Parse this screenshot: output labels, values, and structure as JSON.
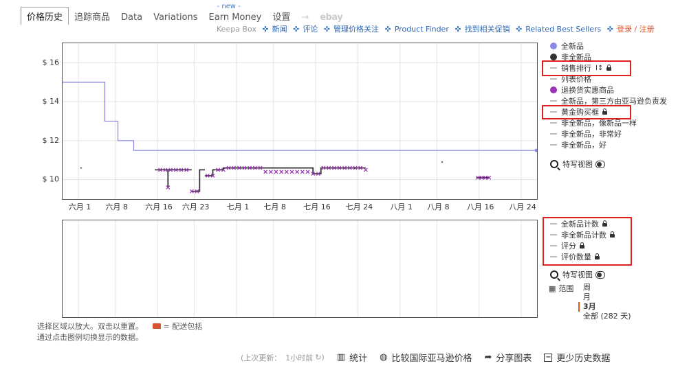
{
  "tabs": [
    {
      "label": "价格历史",
      "active": true
    },
    {
      "label": "追踪商品"
    },
    {
      "label": "Data"
    },
    {
      "label": "Variations"
    },
    {
      "label": "Earn Money",
      "badge": "- new -"
    },
    {
      "label": "设置"
    },
    {
      "label": "→"
    },
    {
      "label": "ebay"
    }
  ],
  "subnav": {
    "brand": "Keepa Box",
    "items": [
      "新闻",
      "评论",
      "管理价格关注",
      "Product Finder",
      "找到相关促销",
      "Related Best Sellers"
    ],
    "login": "登录 / 注册"
  },
  "chart_data": [
    {
      "type": "line",
      "x_ticks": [
        "六月 1",
        "六月 8",
        "六月 16",
        "六月 23",
        "七月 1",
        "七月 8",
        "七月 16",
        "七月 24",
        "八月 1",
        "八月 8",
        "八月 16",
        "八月 24"
      ],
      "y_ticks": [
        "$ 10",
        "$ 12",
        "$ 14",
        "$ 16"
      ],
      "ylim": [
        9,
        17
      ],
      "x_range": [
        -3,
        87
      ],
      "series": [
        {
          "name": "全新品",
          "color": "#8a8ae6",
          "kind": "step",
          "points": [
            [
              -3,
              15
            ],
            [
              5,
              15
            ],
            [
              5,
              13
            ],
            [
              7.5,
              13
            ],
            [
              7.5,
              12
            ],
            [
              10.5,
              12
            ],
            [
              10.5,
              11.5
            ],
            [
              87,
              11.5
            ]
          ]
        },
        {
          "name": "非全新品",
          "color": "#333333",
          "kind": "step",
          "segments": [
            [
              [
                14.5,
                10.5
              ],
              [
                17,
                10.5
              ],
              [
                17,
                9.6
              ],
              [
                17,
                10.5
              ],
              [
                21.5,
                10.5
              ]
            ],
            [
              [
                21.5,
                9.4
              ],
              [
                23,
                9.4
              ],
              [
                23,
                10.5
              ],
              [
                24,
                10.5
              ]
            ],
            [
              [
                24,
                10.2
              ],
              [
                25.5,
                10.2
              ],
              [
                25.5,
                10.5
              ],
              [
                27.5,
                10.5
              ],
              [
                27.5,
                10.6
              ],
              [
                44.5,
                10.6
              ],
              [
                44.5,
                10.3
              ],
              [
                46,
                10.3
              ],
              [
                46,
                10.6
              ],
              [
                54.5,
                10.6
              ]
            ],
            [
              [
                75.5,
                10.1
              ],
              [
                78,
                10.1
              ]
            ]
          ],
          "dots": [
            [
              0.5,
              10.6
            ],
            [
              69,
              10.9
            ]
          ]
        },
        {
          "name": "退换货实惠商品",
          "color": "#9b2fb5",
          "kind": "markers",
          "points": [
            [
              15.5,
              10.5
            ],
            [
              16.5,
              10.5
            ],
            [
              17,
              9.6
            ],
            [
              17.5,
              10.5
            ],
            [
              18.5,
              10.5
            ],
            [
              19.5,
              10.5
            ],
            [
              20.5,
              10.5
            ],
            [
              21.5,
              9.4
            ],
            [
              22.5,
              9.4
            ],
            [
              24.5,
              10.2
            ],
            [
              25.5,
              10.2
            ],
            [
              26.5,
              10.5
            ],
            [
              27.5,
              10.5
            ],
            [
              28.5,
              10.6
            ],
            [
              29.5,
              10.6
            ],
            [
              30.5,
              10.6
            ],
            [
              31.5,
              10.6
            ],
            [
              32.5,
              10.6
            ],
            [
              33.5,
              10.6
            ],
            [
              34.5,
              10.6
            ],
            [
              35.5,
              10.4
            ],
            [
              36.5,
              10.4
            ],
            [
              37.5,
              10.4
            ],
            [
              38.5,
              10.4
            ],
            [
              39.5,
              10.4
            ],
            [
              40.5,
              10.4
            ],
            [
              41.5,
              10.4
            ],
            [
              42.5,
              10.4
            ],
            [
              43.5,
              10.4
            ],
            [
              44.5,
              10.3
            ],
            [
              45.5,
              10.3
            ],
            [
              46.5,
              10.6
            ],
            [
              47.5,
              10.6
            ],
            [
              48.5,
              10.6
            ],
            [
              49.5,
              10.6
            ],
            [
              50.5,
              10.6
            ],
            [
              51.5,
              10.6
            ],
            [
              52.5,
              10.6
            ],
            [
              53.5,
              10.6
            ],
            [
              54.5,
              10.5
            ],
            [
              75.8,
              10.1
            ],
            [
              76.5,
              10.1
            ],
            [
              77.2,
              10.1
            ],
            [
              77.9,
              10.1
            ]
          ]
        }
      ]
    },
    {
      "type": "line",
      "x_ticks_hidden": true,
      "series": []
    }
  ],
  "legend_top": {
    "items": [
      {
        "label": "全新品",
        "kind": "dot",
        "color": "#8a8ae6"
      },
      {
        "label": "非全新品",
        "kind": "dot",
        "color": "#333333"
      },
      {
        "label": "销售排行",
        "kind": "dash",
        "lock": true,
        "extra": "I↕"
      },
      {
        "label": "列表价格",
        "kind": "dash"
      },
      {
        "label": "退换货实惠商品",
        "kind": "dot",
        "color": "#9b2fb5"
      },
      {
        "label": "全新品，第三方由亚马逊负责发",
        "kind": "dash"
      },
      {
        "label": "黄金购买框",
        "kind": "dash",
        "lock": true
      },
      {
        "label": "非全新品，像新品一样",
        "kind": "dash"
      },
      {
        "label": "非全新品，非常好",
        "kind": "dash"
      },
      {
        "label": "非全新品，好",
        "kind": "dash"
      }
    ],
    "special_view": "特写视图"
  },
  "legend_bottom": {
    "items": [
      {
        "label": "全新品计数",
        "lock": true
      },
      {
        "label": "非全新品计数",
        "lock": true
      },
      {
        "label": "评分",
        "lock": true
      },
      {
        "label": "评价数量",
        "lock": true
      }
    ],
    "special_view": "特写视图",
    "range_label": "范围",
    "range_options": [
      "周",
      "月",
      "3月",
      "全部 (282 天)"
    ],
    "range_selected": "3月"
  },
  "notes": {
    "line1": "选择区域以放大。双击以重置。",
    "shipping_icon": "truck-icon",
    "line1b": "= 配送包括",
    "line2": "通过点击图例切换显示的数据。"
  },
  "bottom_bar": {
    "last_update_label": "(上次更新：",
    "last_update_value": "1小时前",
    "refresh_icon": "refresh-icon",
    "stats": "统计",
    "compare": "比较国际亚马逊价格",
    "share": "分享图表",
    "less_history": "更少历史数据"
  }
}
